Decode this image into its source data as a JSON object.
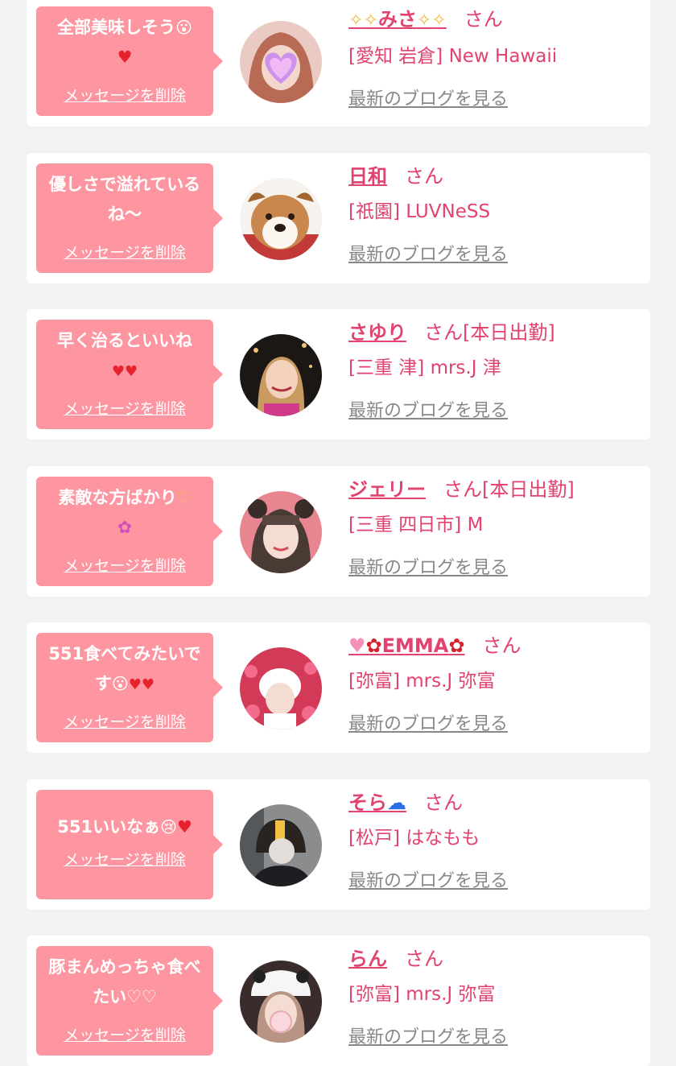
{
  "entries": [
    {
      "message": "全部美味しそう",
      "message_icons": [
        "drooling-face-icon",
        "red-heart-icon"
      ],
      "delete_label": "メッセージを削除",
      "name_prefix_icons": [
        "sparkles-icon",
        "sparkles-icon"
      ],
      "name": "みさ",
      "name_suffix_icons": [
        "sparkles-icon",
        "sparkles-icon"
      ],
      "honorific": "さん",
      "status": "",
      "shop": "[愛知 岩倉] New Hawaii",
      "blog_label": "最新のブログを見る"
    },
    {
      "message": "優しさで溢れているね〜",
      "message_icons": [],
      "delete_label": "メッセージを削除",
      "name": "日和",
      "honorific": "さん",
      "status": "",
      "shop": "[祇園] LUVNeSS",
      "blog_label": "最新のブログを見る"
    },
    {
      "message": "早く治るといいね",
      "message_icons": [
        "two-hearts-icon"
      ],
      "delete_label": "メッセージを削除",
      "name": "さゆり",
      "honorific": "さん",
      "status": "[本日出勤]",
      "shop": "[三重 津] mrs.J 津",
      "blog_label": "最新のブログを見る"
    },
    {
      "message": "素敵な方ばかり",
      "message_icons": [
        "heart-hands-icon",
        "flower-icon"
      ],
      "delete_label": "メッセージを削除",
      "name": "ジェリー",
      "honorific": "さん",
      "status": "[本日出勤]",
      "shop": "[三重 四日市] M",
      "blog_label": "最新のブログを見る"
    },
    {
      "message": "551食べてみたいです",
      "message_icons": [
        "drooling-face-icon",
        "two-hearts-icon"
      ],
      "delete_label": "メッセージを削除",
      "name_prefix_icons": [
        "pink-heart-icon",
        "rose-icon"
      ],
      "name": "EMMA",
      "name_suffix_icons": [
        "rose-icon"
      ],
      "honorific": "さん",
      "status": "",
      "shop": "[弥富] mrs.J 弥富",
      "blog_label": "最新のブログを見る"
    },
    {
      "message": "551いいなぁ",
      "message_icons": [
        "pleading-face-icon",
        "red-heart-icon"
      ],
      "delete_label": "メッセージを削除",
      "name": "そら",
      "name_suffix_icons": [
        "cloud-icon"
      ],
      "honorific": "さん",
      "status": "",
      "shop": "[松戸] はなもも",
      "blog_label": "最新のブログを見る"
    },
    {
      "message": "豚まんめっちゃ食べたい♡♡",
      "message_icons": [],
      "delete_label": "メッセージを削除",
      "name": "らん",
      "honorific": "さん",
      "status": "",
      "shop": "[弥富] mrs.J 弥富",
      "blog_label": "最新のブログを見る"
    }
  ],
  "colors": {
    "background": "#f2f2f2",
    "card": "#ffffff",
    "bubble": "#fe96a1",
    "accent_pink": "#e2426e",
    "link_gray": "#888888"
  }
}
